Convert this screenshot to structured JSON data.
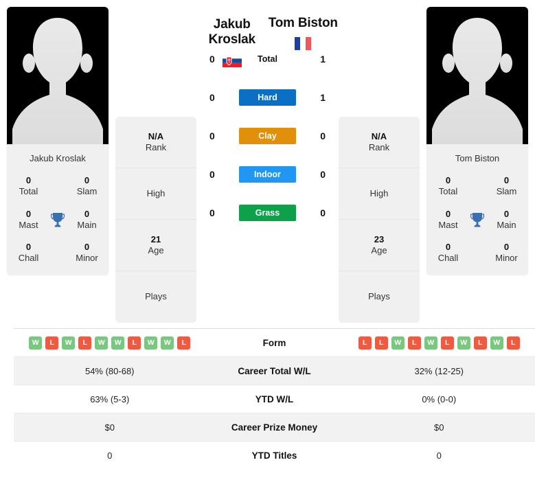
{
  "players": {
    "left": {
      "name_line1": "Jakub",
      "name_line2": "Kroslak",
      "full_name": "Jakub Kroslak",
      "photo_caption": "Jakub Kroslak",
      "flag": "slovakia-flag",
      "rank_value": "N/A",
      "rank_label": "Rank",
      "high_label": "High",
      "age_value": "21",
      "age_label": "Age",
      "plays_label": "Plays",
      "titles": [
        {
          "num": "0",
          "label": "Total"
        },
        {
          "num": "0",
          "label": "Slam"
        },
        {
          "num": "0",
          "label": "Mast"
        },
        {
          "num": "0",
          "label": "Main"
        },
        {
          "num": "0",
          "label": "Chall"
        },
        {
          "num": "0",
          "label": "Minor"
        }
      ],
      "form": [
        "W",
        "L",
        "W",
        "L",
        "W",
        "W",
        "L",
        "W",
        "W",
        "L"
      ],
      "career_total_wl": "54% (80-68)",
      "ytd_wl": "63% (5-3)",
      "career_prize_money": "$0",
      "ytd_titles": "0"
    },
    "right": {
      "name_line1": "Tom Biston",
      "name_line2": "",
      "full_name": "Tom Biston",
      "photo_caption": "Tom Biston",
      "flag": "france-flag",
      "rank_value": "N/A",
      "rank_label": "Rank",
      "high_label": "High",
      "age_value": "23",
      "age_label": "Age",
      "plays_label": "Plays",
      "titles": [
        {
          "num": "0",
          "label": "Total"
        },
        {
          "num": "0",
          "label": "Slam"
        },
        {
          "num": "0",
          "label": "Mast"
        },
        {
          "num": "0",
          "label": "Main"
        },
        {
          "num": "0",
          "label": "Chall"
        },
        {
          "num": "0",
          "label": "Minor"
        }
      ],
      "form": [
        "L",
        "L",
        "W",
        "L",
        "W",
        "L",
        "W",
        "L",
        "W",
        "L"
      ],
      "career_total_wl": "32% (12-25)",
      "ytd_wl": "0% (0-0)",
      "career_prize_money": "$0",
      "ytd_titles": "0"
    }
  },
  "h2h": {
    "rows": [
      {
        "left": "0",
        "label": "Total",
        "right": "1",
        "color": "none",
        "style": "plain"
      },
      {
        "left": "0",
        "label": "Hard",
        "right": "1",
        "color": "#0b6fc4",
        "style": "badge"
      },
      {
        "left": "0",
        "label": "Clay",
        "right": "0",
        "color": "#e0900b",
        "style": "badge"
      },
      {
        "left": "0",
        "label": "Indoor",
        "right": "0",
        "color": "#2196f3",
        "style": "badge"
      },
      {
        "left": "0",
        "label": "Grass",
        "right": "0",
        "color": "#0ea04a",
        "style": "badge"
      }
    ]
  },
  "stats_table": {
    "rows": [
      {
        "key": "form",
        "label": "Form",
        "type": "form"
      },
      {
        "key": "career_wl",
        "label": "Career Total W/L",
        "type": "text",
        "left": "54% (80-68)",
        "right": "32% (12-25)"
      },
      {
        "key": "ytd_wl",
        "label": "YTD W/L",
        "type": "text",
        "left": "63% (5-3)",
        "right": "0% (0-0)"
      },
      {
        "key": "prize",
        "label": "Career Prize Money",
        "type": "text",
        "left": "$0",
        "right": "$0"
      },
      {
        "key": "ytd_titles",
        "label": "YTD Titles",
        "type": "text",
        "left": "0",
        "right": "0"
      }
    ]
  },
  "colors": {
    "hard": "#0b6fc4",
    "clay": "#e0900b",
    "indoor": "#2196f3",
    "grass": "#0ea04a",
    "win_badge": "#7ac77f",
    "loss_badge": "#ee5a42",
    "trophy": "#3b6fb0",
    "card_bg": "#f0f0f0"
  },
  "icons": {
    "trophy": "trophy-icon",
    "avatar": "avatar-placeholder-icon"
  }
}
